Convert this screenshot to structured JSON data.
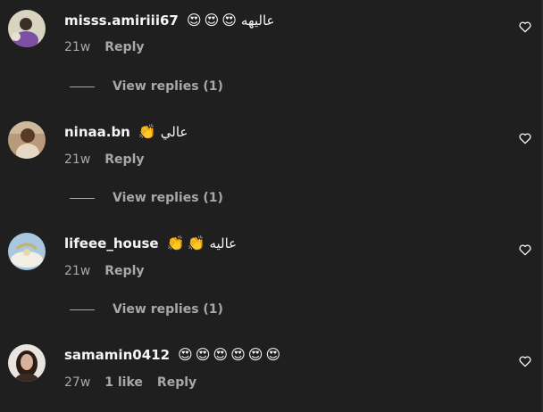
{
  "comments": [
    {
      "username": "misss.amiriii67",
      "emojis_before": [
        "😍",
        "😍",
        "😍"
      ],
      "text": "عاليهه",
      "emojis_after": [],
      "time": "21w",
      "likes": "",
      "reply_label": "Reply",
      "view_replies": "View replies (1)"
    },
    {
      "username": "ninaa.bn",
      "emojis_before": [
        "👏"
      ],
      "text": "عالي",
      "emojis_after": [],
      "time": "21w",
      "likes": "",
      "reply_label": "Reply",
      "view_replies": "View replies (1)"
    },
    {
      "username": "lifeee_house",
      "emojis_before": [
        "👏",
        "👏"
      ],
      "text": "عاليه",
      "emojis_after": [],
      "time": "21w",
      "likes": "",
      "reply_label": "Reply",
      "view_replies": "View replies (1)"
    },
    {
      "username": "samamin0412",
      "emojis_before": [
        "😍",
        "😍",
        "😍",
        "😍",
        "😍",
        "😍"
      ],
      "text": "",
      "emojis_after": [],
      "time": "27w",
      "likes": "1 like",
      "reply_label": "Reply",
      "view_replies": ""
    }
  ],
  "icons": {
    "like": "heart-outline-icon"
  },
  "colors": {
    "background": "#1f1f1f",
    "text_primary": "#f5f5f5",
    "text_secondary": "#a8a8a8"
  }
}
